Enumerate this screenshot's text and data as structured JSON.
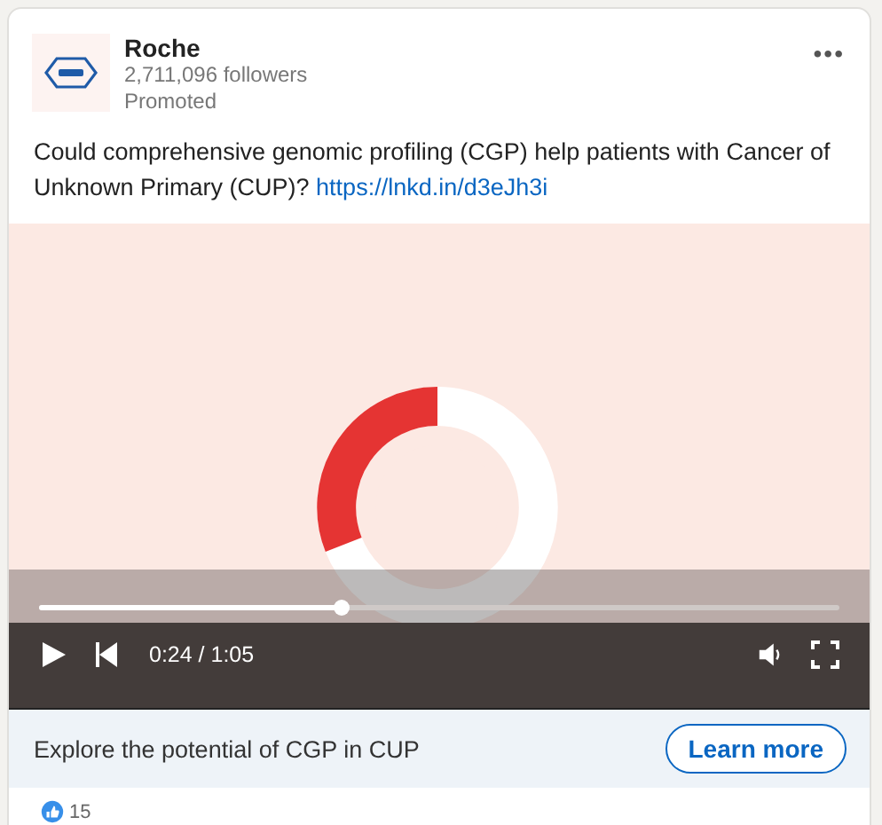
{
  "post": {
    "author": "Roche",
    "followers": "2,711,096 followers",
    "label": "Promoted",
    "more": "•••",
    "text": "Could comprehensive genomic profiling (CGP) help patients with Cancer of Unknown Primary (CUP)?",
    "link": "https://lnkd.in/d3eJh3i"
  },
  "video": {
    "kind": "picture",
    "playing": false,
    "level": 0.376,
    "time": "0:24 / 1:05"
  },
  "cta": {
    "text": "Explore the potential of CGP in CUP",
    "button": "Learn more"
  },
  "reactions": {
    "count": "15"
  }
}
